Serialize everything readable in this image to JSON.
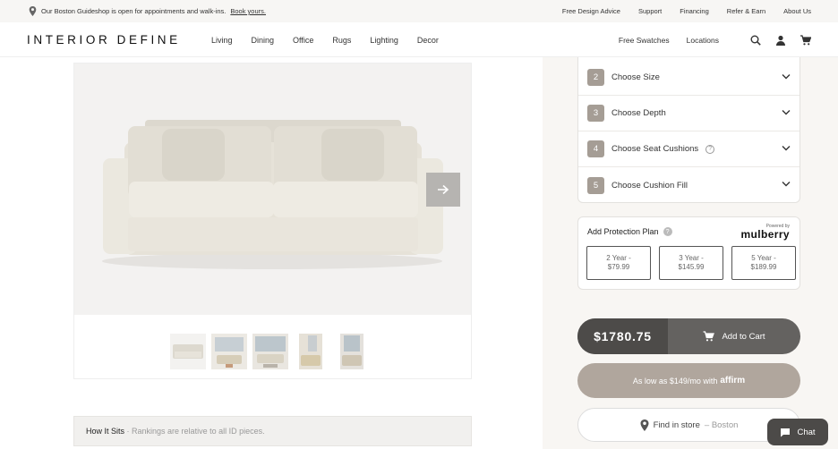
{
  "announcement": {
    "text": "Our Boston Guideshop is open for appointments and walk-ins.",
    "link": "Book yours."
  },
  "top_links": [
    "Free Design Advice",
    "Support",
    "Financing",
    "Refer & Earn",
    "About Us"
  ],
  "header": {
    "logo": "INTERIOR DEFINE",
    "nav": [
      "Living",
      "Dining",
      "Office",
      "Rugs",
      "Lighting",
      "Decor"
    ],
    "right_links": [
      "Free Swatches",
      "Locations"
    ],
    "icons": [
      "search-icon",
      "account-icon",
      "cart-icon"
    ]
  },
  "gallery": {
    "thumbnail_count": 5,
    "next_icon": "arrow-right-icon"
  },
  "how_it_sits": {
    "title": "How It Sits",
    "subtitle": "· Rankings are relative to all ID pieces."
  },
  "steps": [
    {
      "number": "2",
      "label": "Choose Size",
      "help": false
    },
    {
      "number": "3",
      "label": "Choose Depth",
      "help": false
    },
    {
      "number": "4",
      "label": "Choose Seat Cushions",
      "help": true
    },
    {
      "number": "5",
      "label": "Choose Cushion Fill",
      "help": false
    }
  ],
  "protection": {
    "title": "Add Protection Plan",
    "help_glyph": "?",
    "powered_by": "Powered by",
    "brand": "mulberry",
    "plans": [
      {
        "term": "2 Year -",
        "price": "$79.99"
      },
      {
        "term": "3 Year -",
        "price": "$145.99"
      },
      {
        "term": "5 Year -",
        "price": "$189.99"
      }
    ]
  },
  "cart": {
    "price": "$1780.75",
    "add_label": "Add to Cart"
  },
  "financing": {
    "text": "As low as $149/mo with",
    "brand": "affirm"
  },
  "find_store": {
    "label": "Find in store",
    "location": "– Boston"
  },
  "chat": {
    "label": "Chat"
  },
  "colors": {
    "accent_taupe": "#b0a69d",
    "step_badge": "#a59d95",
    "cart_dark": "#4d4b49",
    "cart_mid": "#646260"
  }
}
